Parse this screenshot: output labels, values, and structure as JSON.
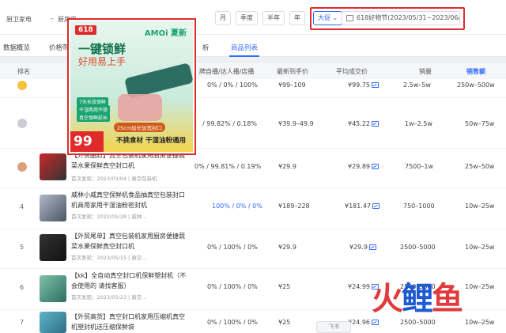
{
  "filters": {
    "category": "厨卫家电",
    "sep": "–",
    "subcategory": "厨房电…",
    "periods": [
      "月",
      "季度",
      "半年",
      "年"
    ],
    "promo_label": "大促",
    "promo_range": "618好物节(2023/05/31~2023/06/18)"
  },
  "tabs": [
    "数据概览",
    "价格带",
    "析",
    "商品列表"
  ],
  "table": {
    "headers": [
      "排名",
      "牌自播/达人播/店播",
      "最新到手价",
      "平均成交价",
      "销量",
      "销售额"
    ],
    "rows": [
      {
        "rank": "",
        "title": "",
        "meta": "",
        "ratio": "0% / 0% / 100%",
        "price": "¥99–109",
        "avg": "¥99.75",
        "volume": "2.5w–5w",
        "sales": "250w–500w"
      },
      {
        "rank": "",
        "title": "",
        "meta": "",
        "ratio": "/ 99.82% / 0.18%",
        "price": "¥39.9–49.9",
        "avg": "¥45.22",
        "volume": "1w–2.5w",
        "sales": "50w–75w"
      },
      {
        "rank": "",
        "title": "【外贸品质】真空包装机家用厨房便捷蔬菜水果保鲜真空封口机",
        "meta": "首次发现：2023/03/04 | 真空包装机",
        "ratio": "0% / 99.81% / 0.19%",
        "price": "¥29.9",
        "avg": "¥29.89",
        "volume": "7500–1w",
        "sales": "25w–50w"
      },
      {
        "rank": "4",
        "title": "威林小威真空保鲜机食品抽真空包装封口机商用家用干湿油粉密封机",
        "meta": "首次发现：2022/05/28 | 威林…",
        "ratio": "100% / 0% / 0%",
        "price": "¥189–228",
        "avg": "¥181.47",
        "volume": "750–1000",
        "sales": "10w–25w"
      },
      {
        "rank": "5",
        "title": "【外贸尾单】真空包装机家用厨房便捷蔬菜水果保鲜真空封口机",
        "meta": "首次发现：2023/05/15 | 真空…",
        "ratio": "0% / 100% / 0%",
        "price": "¥29.9",
        "avg": "¥29.9",
        "volume": "2500–5000",
        "sales": "10w–25w"
      },
      {
        "rank": "6",
        "title": "【kk】全自动真空封口机保鲜塑封机（不会使用的 请找客服）",
        "meta": "首次发现：2023/05/23 | 真空…",
        "ratio": "0% / 100% / 0%",
        "price": "¥25",
        "avg": "¥24.99",
        "volume": "2500–5000",
        "sales": "10w–25w"
      },
      {
        "rank": "7",
        "title": "【外贸高货】真空封口机家用压缩机真空机塑封机送压缩保鲜袋",
        "meta": "",
        "ratio": "0% / 100% / 0%",
        "price": "¥25",
        "avg": "¥24.96",
        "volume": "2500–5000",
        "sales": "10w–25w"
      }
    ]
  },
  "popup": {
    "badge": "618",
    "brand": "AMOi 夏新",
    "headline": "一键锁鲜",
    "subline": "好用易上手",
    "features": [
      "7天长效保鲜",
      "干湿两用不锁",
      "真空保鲜延长"
    ],
    "spec": "25cm加长加宽封口",
    "price": "99",
    "slogan": "不挑食材 干湿油粉通用"
  },
  "watermark": {
    "part1": "火",
    "part2": "鲤",
    "part3": "鱼"
  },
  "lark_label": "飞书"
}
